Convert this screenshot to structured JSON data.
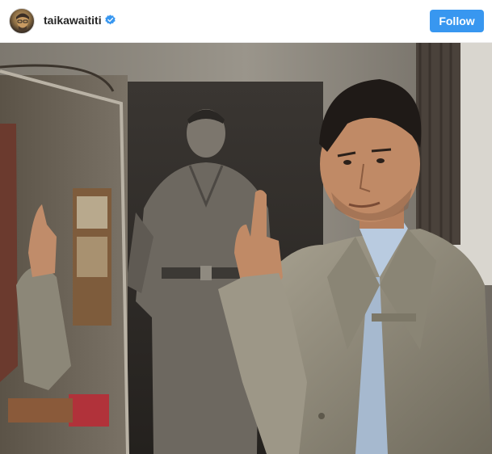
{
  "post": {
    "username": "taikawaititi",
    "verified": true,
    "follow_label": "Follow",
    "avatar_icon": "profile-photo",
    "verified_icon": "verified-badge-icon"
  },
  "photo": {
    "alt": ""
  },
  "colors": {
    "follow_bg": "#3897f0",
    "verified": "#3897f0",
    "username": "#262626"
  }
}
